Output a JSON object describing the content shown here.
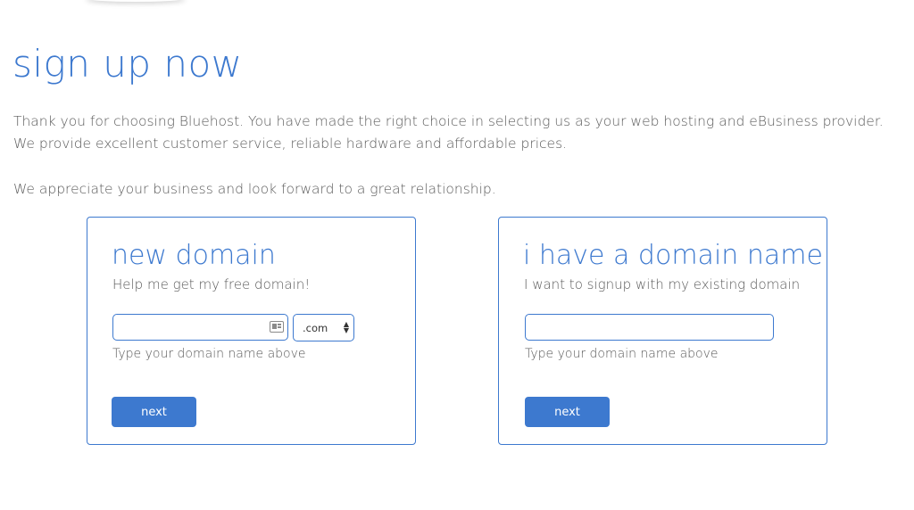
{
  "page": {
    "title": "sign up now",
    "intro_line1": "Thank you for choosing Bluehost. You have made the right choice in selecting us as your web hosting and eBusiness provider.",
    "intro_line2": "We provide excellent customer service, reliable hardware and affordable prices.",
    "intro_line3": "We appreciate your business and look forward to a great relationship."
  },
  "new_domain": {
    "title": "new domain",
    "subtitle": "Help me get my free domain!",
    "input_value": "",
    "tld_selected": ".com",
    "helper": "Type your domain name above",
    "button_label": "next",
    "icon": "contact-card-icon"
  },
  "existing_domain": {
    "title": "i have a domain name",
    "subtitle": "I want to signup with my existing domain",
    "input_value": "",
    "helper": "Type your domain name above",
    "button_label": "next"
  },
  "colors": {
    "accent": "#3d79cf",
    "text": "#5b5b5b",
    "background": "#ffffff"
  }
}
